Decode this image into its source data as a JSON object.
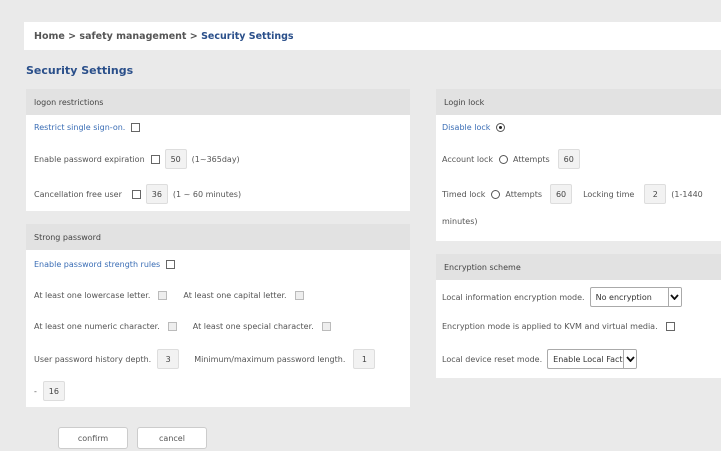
{
  "breadcrumb": {
    "home": "Home",
    "sep1": ">",
    "section": "safety management",
    "sep2": ">",
    "current": "Security Settings"
  },
  "page_title": "Security Settings",
  "logon_restrictions": {
    "header": "logon restrictions",
    "restrict_sso_label": "Restrict single sign-on.",
    "restrict_sso_checked": false,
    "password_expiration_label": "Enable password expiration",
    "password_expiration_checked": false,
    "password_expiration_value": "50",
    "password_expiration_range": "(1~365day)",
    "cancellation_label": "Cancellation free user",
    "cancellation_checked": false,
    "cancellation_value": "36",
    "cancellation_range": "(1 ~ 60 minutes)"
  },
  "strong_password": {
    "header": "Strong password",
    "enable_label": "Enable password strength rules",
    "enable_checked": false,
    "lowercase_label": "At least one lowercase letter.",
    "capital_label": "At least one capital letter.",
    "numeric_label": "At least one numeric character.",
    "special_label": "At least one special character.",
    "history_label": "User password history depth.",
    "history_value": "3",
    "minmax_label": "Minimum/maximum password length.",
    "min_value": "1",
    "dash": "-",
    "max_value": "16"
  },
  "login_lock": {
    "header": "Login lock",
    "disable_label": "Disable lock",
    "account_label": "Account lock",
    "account_attempts_label": "Attempts",
    "account_attempts_value": "60",
    "timed_label": "Timed lock",
    "timed_attempts_label": "Attempts",
    "timed_attempts_value": "60",
    "locking_time_label": "Locking time",
    "locking_time_value": "2",
    "locking_range_a": "(1-1440",
    "locking_range_b": "minutes)",
    "selected": "disable"
  },
  "encryption": {
    "header": "Encryption scheme",
    "local_mode_label": "Local information encryption mode.",
    "local_mode_value": "No encryption",
    "kvm_label": "Encryption mode is applied to KVM and virtual media.",
    "kvm_checked": false,
    "reset_label": "Local device reset mode.",
    "reset_value": "Enable Local Fact"
  },
  "buttons": {
    "confirm": "confirm",
    "cancel": "cancel"
  },
  "colors": {
    "accent": "#2a4f8a",
    "link": "#3a6db5",
    "page_bg": "#eaeaea",
    "panel_head_bg": "#e2e2e2"
  }
}
